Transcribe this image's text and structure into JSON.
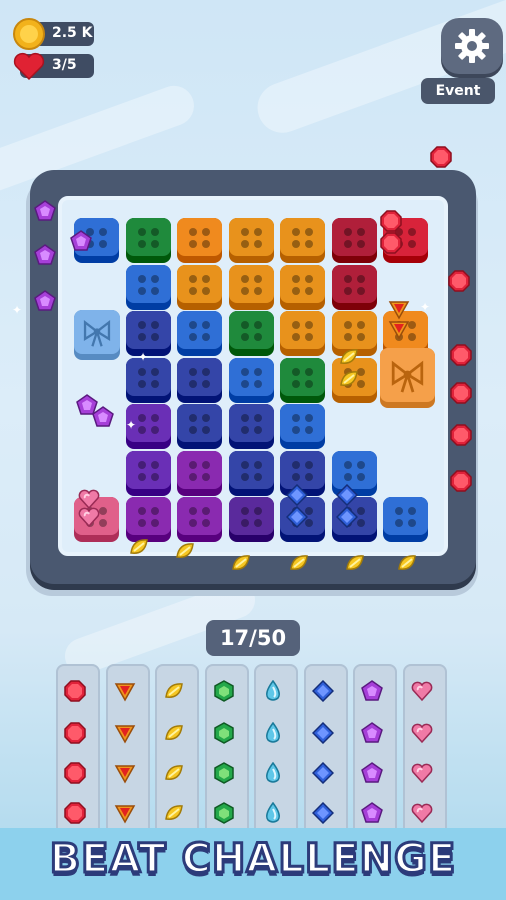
{
  "hud": {
    "coins": "2.5 K",
    "lives": "3/5",
    "event_label": "Event"
  },
  "progress": {
    "counter": "17/50",
    "collected": 17,
    "total": 50
  },
  "banner": {
    "text": "BEAT CHALLENGE"
  },
  "icons": [
    "coin-icon",
    "heart-icon",
    "gear-icon",
    "bow-gift-icon",
    "red-octagon-gem",
    "orange-triangle-gem",
    "yellow-leaf-gem",
    "green-hexagon-gem",
    "aqua-drop-gem",
    "blue-diamond-gem",
    "purple-pentagon-gem",
    "pink-heart-gem"
  ],
  "colors": {
    "red": "#d8233a",
    "green": "#1f8a3c",
    "orange": "#f08a1e",
    "amber": "#e8921c",
    "crimson": "#b01f3a",
    "blue": "#2f6fd6",
    "navy": "#3445a8",
    "purple": "#6a2fb6",
    "magenta": "#8a2ab0",
    "pink": "#e0608a",
    "violet": "#5a2a9c"
  }
}
